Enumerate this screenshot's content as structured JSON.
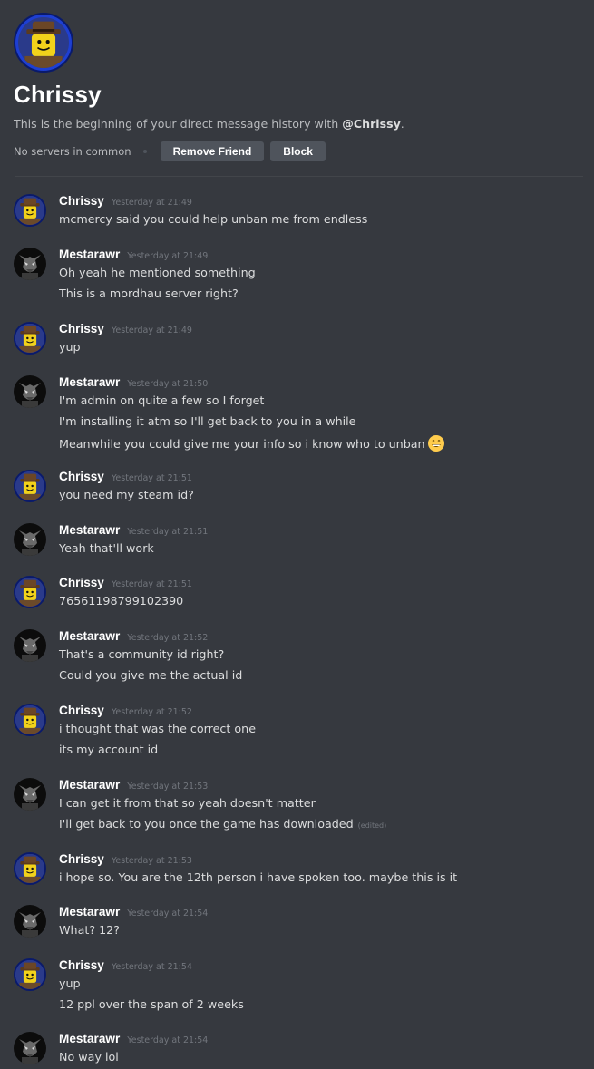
{
  "header": {
    "title": "Chrissy",
    "intro_prefix": "This is the beginning of your direct message history with ",
    "intro_mention": "@Chrissy",
    "intro_suffix": ".",
    "mutual_servers": "No servers in common",
    "remove_friend_label": "Remove Friend",
    "block_label": "Block"
  },
  "colors": {
    "background": "#36393f",
    "button": "#4f545c",
    "avatar_ring": "#1e3fd2"
  },
  "messages": [
    {
      "user": "Chrissy",
      "time": "Yesterday at 21:49",
      "lines": [
        "mcmercy said you could help unban me from endless"
      ]
    },
    {
      "user": "Mestarawr",
      "time": "Yesterday at 21:49",
      "lines": [
        "Oh yeah he mentioned something",
        "This is a mordhau server right?"
      ]
    },
    {
      "user": "Chrissy",
      "time": "Yesterday at 21:49",
      "lines": [
        "yup"
      ]
    },
    {
      "user": "Mestarawr",
      "time": "Yesterday at 21:50",
      "lines": [
        "I'm admin on quite a few so I forget",
        "I'm installing it atm so I'll get back to you in a while",
        "Meanwhile you could give me your info so i know who to unban"
      ],
      "emoji": "grinning-face-emoji"
    },
    {
      "user": "Chrissy",
      "time": "Yesterday at 21:51",
      "lines": [
        "you need my steam id?"
      ]
    },
    {
      "user": "Mestarawr",
      "time": "Yesterday at 21:51",
      "lines": [
        "Yeah that'll work"
      ]
    },
    {
      "user": "Chrissy",
      "time": "Yesterday at 21:51",
      "lines": [
        "76561198799102390"
      ]
    },
    {
      "user": "Mestarawr",
      "time": "Yesterday at 21:52",
      "lines": [
        "That's a community id right?",
        "Could you give me the actual id"
      ]
    },
    {
      "user": "Chrissy",
      "time": "Yesterday at 21:52",
      "lines": [
        "i thought that was the correct one",
        "its my account id"
      ]
    },
    {
      "user": "Mestarawr",
      "time": "Yesterday at 21:53",
      "lines": [
        "I can get it from that so yeah doesn't matter",
        "I'll get back to you once the game has downloaded"
      ],
      "edited": "(edited)"
    },
    {
      "user": "Chrissy",
      "time": "Yesterday at 21:53",
      "lines": [
        "i hope so.  You are the 12th person i have spoken too.  maybe this is it"
      ]
    },
    {
      "user": "Mestarawr",
      "time": "Yesterday at 21:54",
      "lines": [
        "What? 12?"
      ]
    },
    {
      "user": "Chrissy",
      "time": "Yesterday at 21:54",
      "lines": [
        "yup",
        "12 ppl over the span of 2 weeks"
      ]
    },
    {
      "user": "Mestarawr",
      "time": "Yesterday at 21:54",
      "lines": [
        "No way lol"
      ]
    }
  ]
}
